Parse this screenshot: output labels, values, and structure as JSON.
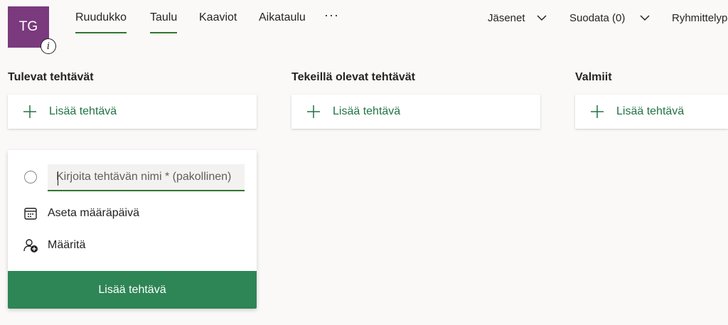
{
  "plan": {
    "avatar_initials": "TG",
    "info_icon": "info-icon"
  },
  "nav": {
    "tabs": [
      {
        "label": "Ruudukko",
        "active": true
      },
      {
        "label": "Taulu",
        "active": true
      },
      {
        "label": "Kaaviot",
        "active": false
      },
      {
        "label": "Aikataulu",
        "active": false
      }
    ],
    "more_label": "···"
  },
  "toolbar": {
    "members_label": "Jäsenet",
    "filter_label": "Suodata (0)",
    "group_label": "Ryhmittelyperuste"
  },
  "columns": [
    {
      "title": "Tulevat tehtävät",
      "add_label": "Lisää tehtävä"
    },
    {
      "title": "Tekeillä olevat tehtävät",
      "add_label": "Lisää tehtävä"
    },
    {
      "title": "Valmiit",
      "add_label": "Lisää tehtävä"
    }
  ],
  "new_task": {
    "name_placeholder": "Kirjoita tehtävän nimi * (pakollinen)",
    "name_value": "",
    "due_date_label": "Aseta määräpäivä",
    "assign_label": "Määritä",
    "submit_label": "Lisää tehtävä"
  },
  "colors": {
    "accent": "#31752f",
    "submit_bg": "#2e8555",
    "avatar_bg": "#7a3a7d",
    "link": "#217346"
  }
}
